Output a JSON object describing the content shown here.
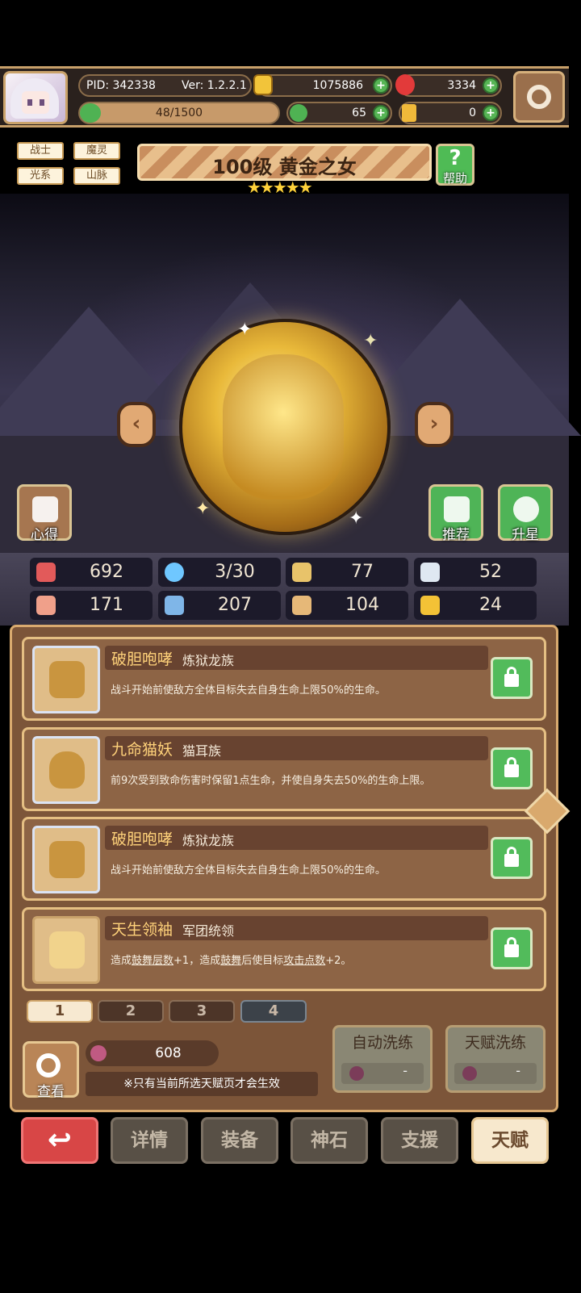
{
  "player": {
    "pid": "PID: 342338",
    "version": "Ver: 1.2.2.1",
    "gold": "1075886",
    "gems": "3334",
    "xp": "48/1500",
    "clover": "65",
    "keys": "0"
  },
  "hero": {
    "tags": [
      "战士",
      "魔灵",
      "光系",
      "山脉"
    ],
    "title": "100级  黄金之女",
    "stars": "★★★★★",
    "help_label": "帮助",
    "left_button_label": "心得",
    "recommend_label": "推荐",
    "upgrade_label": "升星"
  },
  "stats": [
    {
      "icon": "heart-icon",
      "value": "692",
      "color": "#e25a5a"
    },
    {
      "icon": "droplet-icon",
      "value": "3/30",
      "color": "#6fc7ff"
    },
    {
      "icon": "shield-icon",
      "value": "77",
      "color": "#e8c36a"
    },
    {
      "icon": "wing-icon",
      "value": "52",
      "color": "#dfe8f2"
    },
    {
      "icon": "fist-icon",
      "value": "171",
      "color": "#f0a08a"
    },
    {
      "icon": "book-icon",
      "value": "207",
      "color": "#7fb6e8"
    },
    {
      "icon": "scroll-icon",
      "value": "104",
      "color": "#e6b878"
    },
    {
      "icon": "horseshoe-icon",
      "value": "24",
      "color": "#f3c236"
    }
  ],
  "talents": [
    {
      "name": "破胆咆哮",
      "race": "炼狱龙族",
      "desc_parts": [
        "战斗开始前使敌方全体目标失去自身生命上限50%的生命。",
        "",
        "",
        "",
        ""
      ],
      "icon": "dragon-icon"
    },
    {
      "name": "九命猫妖",
      "race": "猫耳族",
      "desc_parts": [
        "前9次受到致命伤害时保留1点生命，并使自身失去50%的生命上限。",
        "",
        "",
        "",
        ""
      ],
      "icon": "cat-icon"
    },
    {
      "name": "破胆咆哮",
      "race": "炼狱龙族",
      "desc_parts": [
        "战斗开始前使敌方全体目标失去自身生命上限50%的生命。",
        "",
        "",
        "",
        ""
      ],
      "icon": "dragon-icon"
    },
    {
      "name": "天生领袖",
      "race": "军团统领",
      "desc_parts": [
        "造成",
        "鼓舞层数",
        "+1，造成",
        "鼓舞",
        "后使目标",
        "攻击点数",
        "+2。"
      ],
      "icon": "star-icon"
    }
  ],
  "pages": [
    "1",
    "2",
    "3",
    "4"
  ],
  "bottom": {
    "look_label": "查看",
    "potion_count": "608",
    "note": "※只有当前所选天赋页才会生效",
    "auto_refine": "自动洗练",
    "talent_refine": "天赋洗练",
    "refine_cost": "-"
  },
  "nav": {
    "back": "↩",
    "details": "详情",
    "equip": "装备",
    "godstone": "神石",
    "support": "支援",
    "talent": "天赋"
  }
}
